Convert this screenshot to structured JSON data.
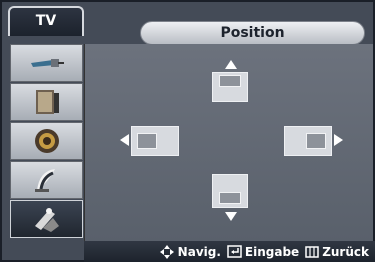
{
  "header": {
    "tab_label": "TV",
    "title": "Position"
  },
  "sidebar": {
    "items": [
      {
        "icon": "antenna-icon"
      },
      {
        "icon": "display-icon"
      },
      {
        "icon": "speaker-icon"
      },
      {
        "icon": "satellite-dish-icon"
      },
      {
        "icon": "tools-icon",
        "active": true
      }
    ]
  },
  "position_controls": {
    "directions": [
      "up",
      "left",
      "right",
      "down"
    ]
  },
  "footer": {
    "navigate_label": "Navig.",
    "enter_label": "Eingabe",
    "back_label": "Zurück"
  }
}
